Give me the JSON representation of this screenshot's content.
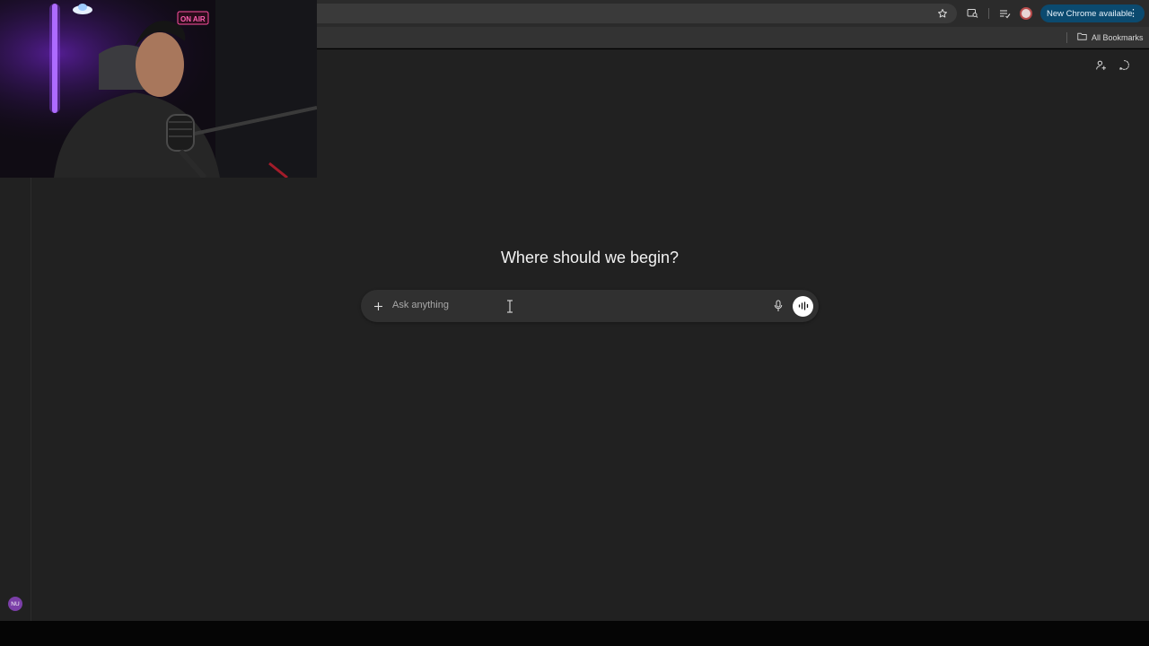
{
  "browser": {
    "update_label": "New Chrome available",
    "update_menu_glyph": "⋮",
    "bookmarks_label": "All Bookmarks",
    "icons": [
      "star-icon",
      "tab-search-icon",
      "reading-list-icon",
      "profile-avatar-icon",
      "folder-icon"
    ]
  },
  "webcam": {
    "sign_text": "ON AIR"
  },
  "app": {
    "headline": "Where should we begin?",
    "composer": {
      "placeholder": "Ask anything"
    },
    "user_initials": "NU",
    "top_actions": [
      "add-person-icon",
      "temporary-chat-icon"
    ]
  },
  "colors": {
    "background": "#212121",
    "composer": "#303030",
    "update_button": "#0b4a6f",
    "avatar": "#7b3fa8"
  }
}
